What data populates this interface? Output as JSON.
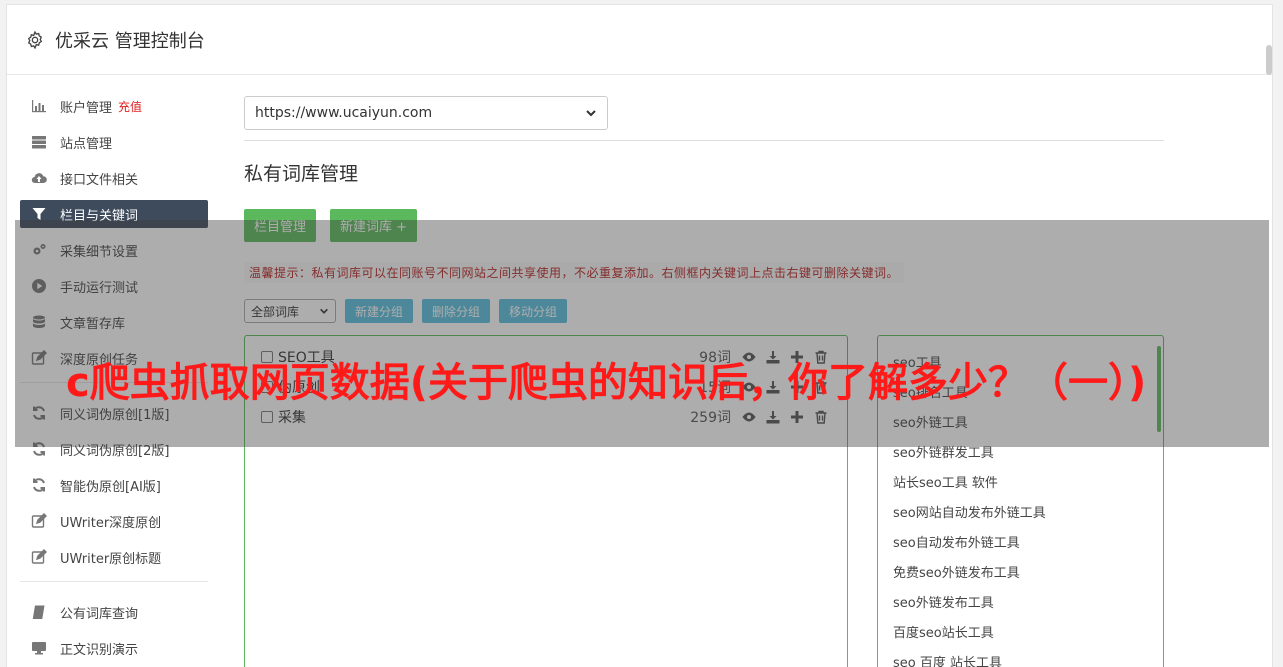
{
  "header": {
    "title": "优采云 管理控制台",
    "icon": "gear-icon"
  },
  "sidebar": {
    "items": [
      {
        "label": "账户管理",
        "badge": "充值",
        "icon": "bar-chart-icon"
      },
      {
        "label": "站点管理",
        "icon": "server-icon"
      },
      {
        "label": "接口文件相关",
        "icon": "cloud-upload-icon"
      },
      {
        "label": "栏目与关键词",
        "icon": "filter-icon",
        "active": true
      },
      {
        "label": "采集细节设置",
        "icon": "gears-icon"
      },
      {
        "label": "手动运行测试",
        "icon": "play-circle-icon"
      },
      {
        "label": "文章暂存库",
        "icon": "database-icon"
      },
      {
        "label": "深度原创任务",
        "icon": "edit-icon"
      },
      {
        "label": "同义词伪原创[1版]",
        "icon": "refresh-icon"
      },
      {
        "label": "同义词伪原创[2版]",
        "icon": "refresh-icon"
      },
      {
        "label": "智能伪原创[AI版]",
        "icon": "refresh-icon"
      },
      {
        "label": "UWriter深度原创",
        "icon": "edit-icon"
      },
      {
        "label": "UWriter原创标题",
        "icon": "edit-icon"
      },
      {
        "label": "公有词库查询",
        "icon": "book-icon"
      },
      {
        "label": "正文识别演示",
        "icon": "monitor-icon"
      }
    ]
  },
  "main": {
    "site_select": "https://www.ucaiyun.com",
    "page_title": "私有词库管理",
    "buttons": {
      "column_manage": "栏目管理",
      "new_library": "新建词库 +"
    },
    "tip": "温馨提示：私有词库可以在同账号不同网站之间共享使用，不必重复添加。右侧框内关键词上点击右键可删除关键词。",
    "group_select": "全部词库",
    "group_buttons": {
      "new_group": "新建分组",
      "delete_group": "删除分组",
      "move_group": "移动分组"
    },
    "libraries": [
      {
        "name": "SEO工具",
        "count": "98词"
      },
      {
        "name": "伪原创",
        "count": "15词"
      },
      {
        "name": "采集",
        "count": "259词"
      }
    ],
    "keywords": [
      "seo工具",
      "seo排名工具",
      "seo外链工具",
      "seo外链群发工具",
      "站长seo工具 软件",
      "seo网站自动发布外链工具",
      "seo自动发布外链工具",
      "免费seo外链发布工具",
      "seo外链发布工具",
      "百度seo站长工具",
      "seo 百度 站长工具"
    ]
  },
  "overlay": {
    "title": "c爬虫抓取网页数据(关于爬虫的知识后，你了解多少？（一）)"
  },
  "colors": {
    "accent_green": "#5cb85c",
    "accent_blue": "#5bc0de",
    "active_nav": "#3e4b5c",
    "overlay_text": "#ff1a1a"
  }
}
